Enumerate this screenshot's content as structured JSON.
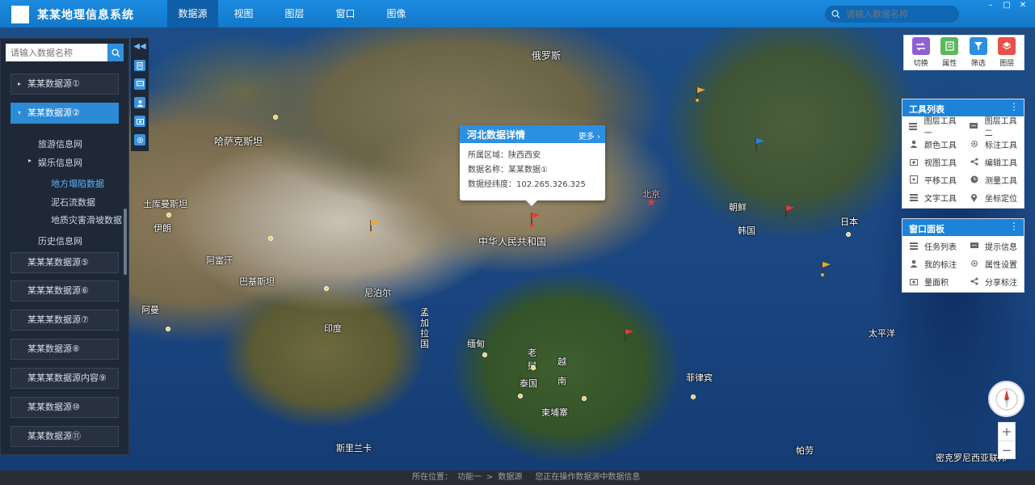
{
  "app": {
    "title": "某某地理信息系统"
  },
  "menu": [
    "数据源",
    "视图",
    "图层",
    "窗口",
    "图像"
  ],
  "top_search": {
    "placeholder": "请输入数据名称"
  },
  "left_panel": {
    "search_placeholder": "请输入数据名称",
    "items": [
      "某某数据源①",
      "某某数据源②",
      "某某某数据源⑤",
      "某某某数据源⑥",
      "某某某数据源⑦",
      "某某数据源⑧",
      "某某某数据源内容⑨",
      "某某数据源⑩",
      "某某数据源⑪"
    ],
    "sub_items": [
      "旅游信息网",
      "娱乐信息网",
      "地方塌陷数据",
      "泥石流数据",
      "地质灾害滑坡数据",
      "历史信息网"
    ]
  },
  "popup": {
    "title": "河北数据详情",
    "more": "更多",
    "rows": [
      "所属区域：陕西西安",
      "数据名称：某某数据①",
      "数据经纬度：102.265.326.325"
    ]
  },
  "right_toolbar": [
    "切换",
    "属性",
    "筛选",
    "图层"
  ],
  "tool_panel": {
    "title": "工具列表",
    "items": [
      "图层工具一",
      "图层工具二",
      "颜色工具",
      "标注工具",
      "视图工具",
      "编辑工具",
      "平移工具",
      "测量工具",
      "文字工具",
      "坐标定位"
    ]
  },
  "window_panel": {
    "title": "窗口面板",
    "items": [
      "任务列表",
      "提示信息",
      "我的标注",
      "属性设置",
      "量面积",
      "分享标注"
    ]
  },
  "map_labels": {
    "russia": "俄罗斯",
    "kazakhstan": "哈萨克斯坦",
    "turkmenistan": "土库曼斯坦",
    "afghanistan": "阿富汗",
    "pakistan": "巴基斯坦",
    "nepal": "尼泊尔",
    "india": "印度",
    "bangladesh": "孟加拉国",
    "myanmar": "缅甸",
    "thailand": "泰国",
    "cambodia": "柬埔寨",
    "laos": "老挝",
    "vietnam": "越南",
    "philippines": "菲律宾",
    "north_korea": "朝鲜",
    "south_korea": "韩国",
    "japan": "日本",
    "china": "中华人民共和国",
    "sri_lanka": "斯里兰卡",
    "palau": "帕劳",
    "micronesia": "密克罗尼西亚联邦",
    "pacific": "太平洋",
    "beijing": "北京",
    "oman": "阿曼",
    "yiran": "伊朗"
  },
  "status": {
    "prefix": "所在位置：",
    "path1": "功能一",
    "sep": ">",
    "path2": "数据源",
    "msg": "您正在操作数据源中数据信息"
  },
  "colors": {
    "accent": "#1b8be0",
    "panel_bg": "#1f2836",
    "active_item": "#2b8bd6"
  }
}
